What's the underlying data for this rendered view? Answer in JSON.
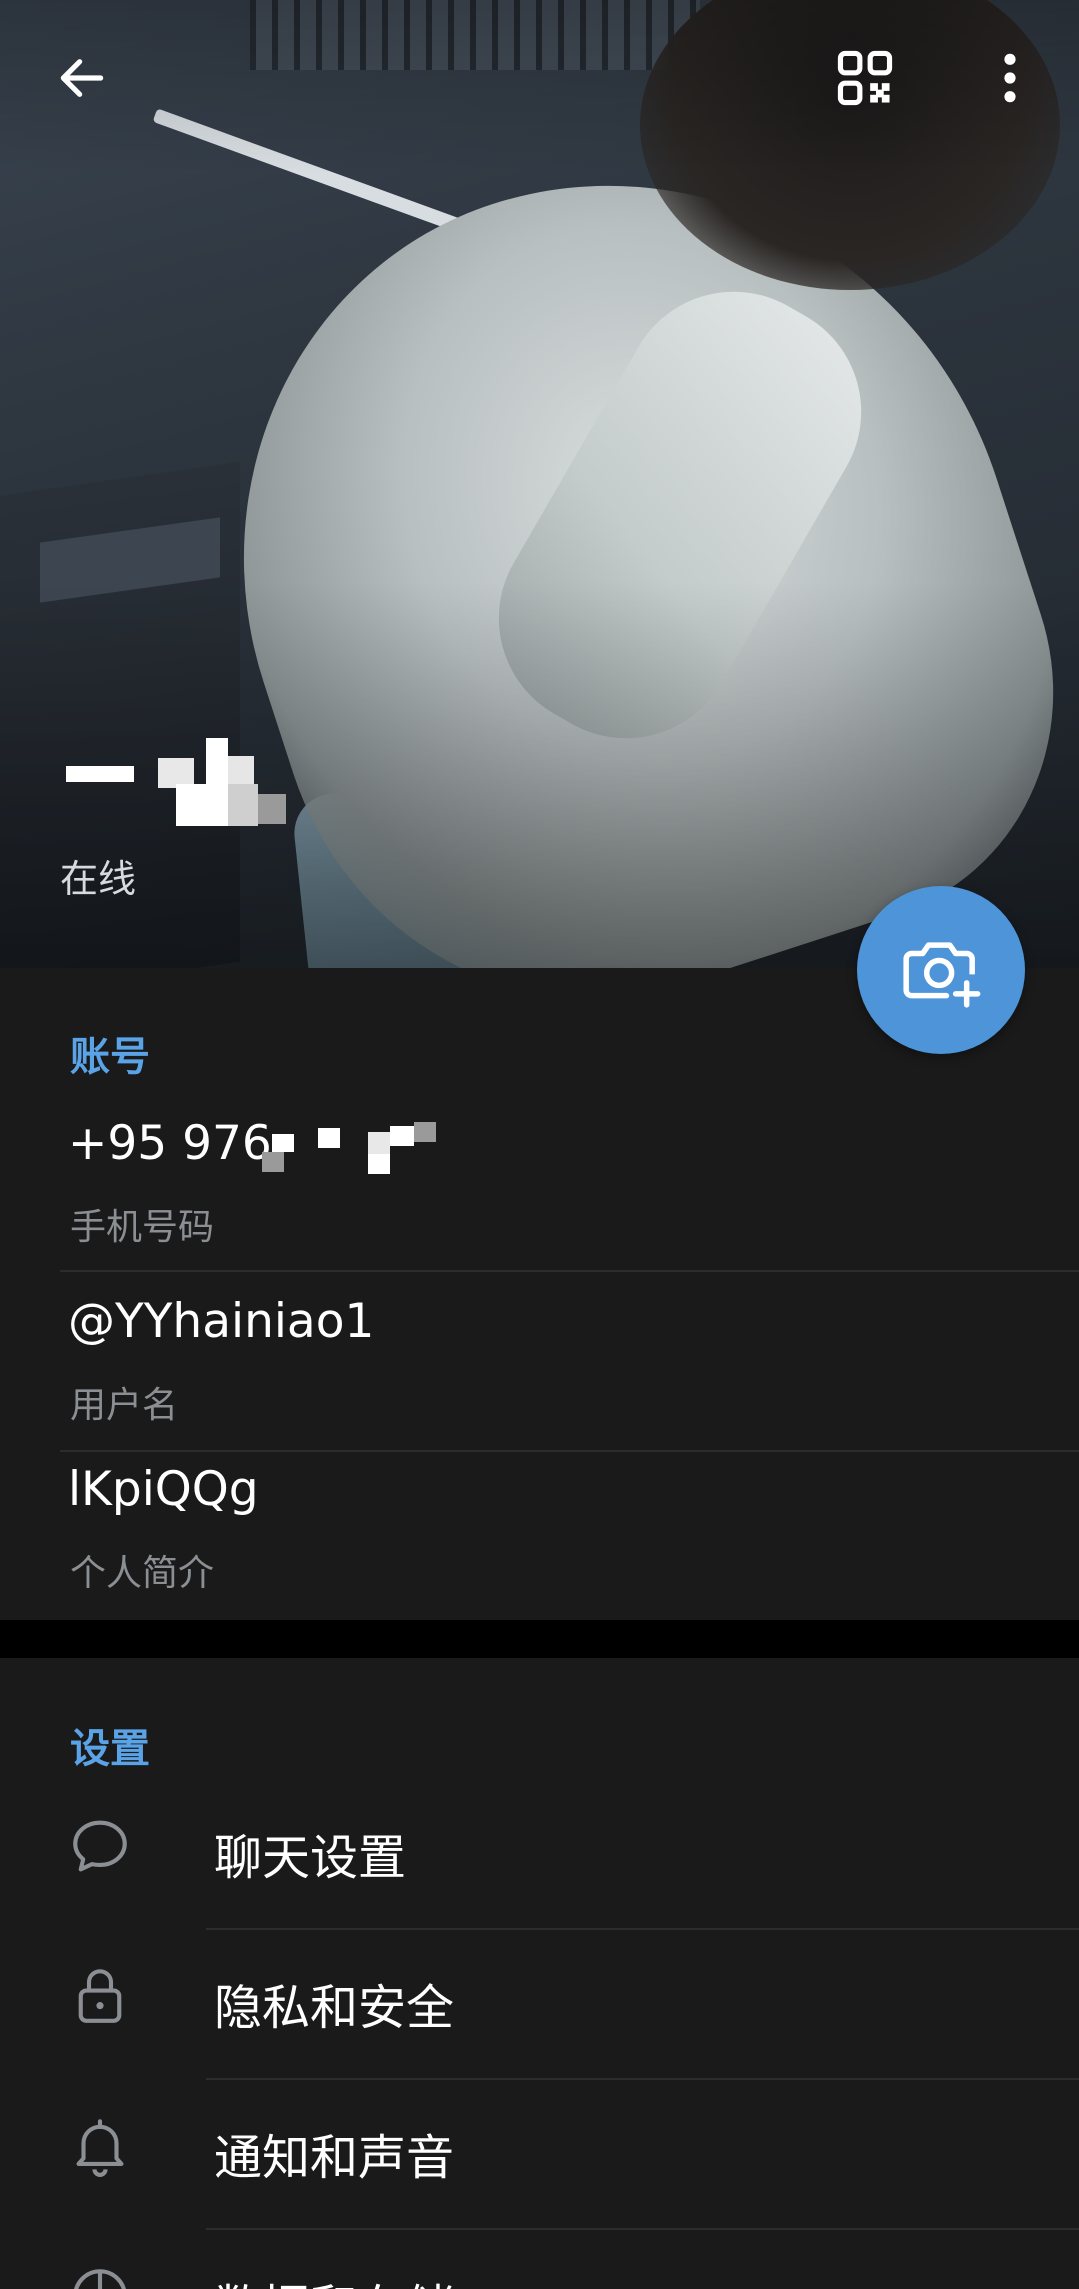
{
  "header": {
    "back_icon": "arrow-left-icon",
    "qr_icon": "qr-code-icon",
    "more_icon": "more-vertical-icon"
  },
  "profile": {
    "status": "在线"
  },
  "fab": {
    "icon": "camera-plus-icon",
    "color": "#4d94d8"
  },
  "account": {
    "title": "账号",
    "phone": {
      "value": "+95 976",
      "label": "手机号码"
    },
    "username": {
      "value": "@YYhainiao1",
      "label": "用户名"
    },
    "bio": {
      "value": "lKpiQQg",
      "label": "个人简介"
    }
  },
  "settings": {
    "title": "设置",
    "items": [
      {
        "label": "聊天设置",
        "icon": "chat-bubble-icon"
      },
      {
        "label": "隐私和安全",
        "icon": "lock-icon"
      },
      {
        "label": "通知和声音",
        "icon": "bell-icon"
      },
      {
        "label": "数据和存储",
        "icon": "pie-chart-icon"
      }
    ]
  },
  "colors": {
    "accent": "#5aa3e6",
    "background": "#1a1a1a",
    "secondary_text": "#8b8f94"
  }
}
